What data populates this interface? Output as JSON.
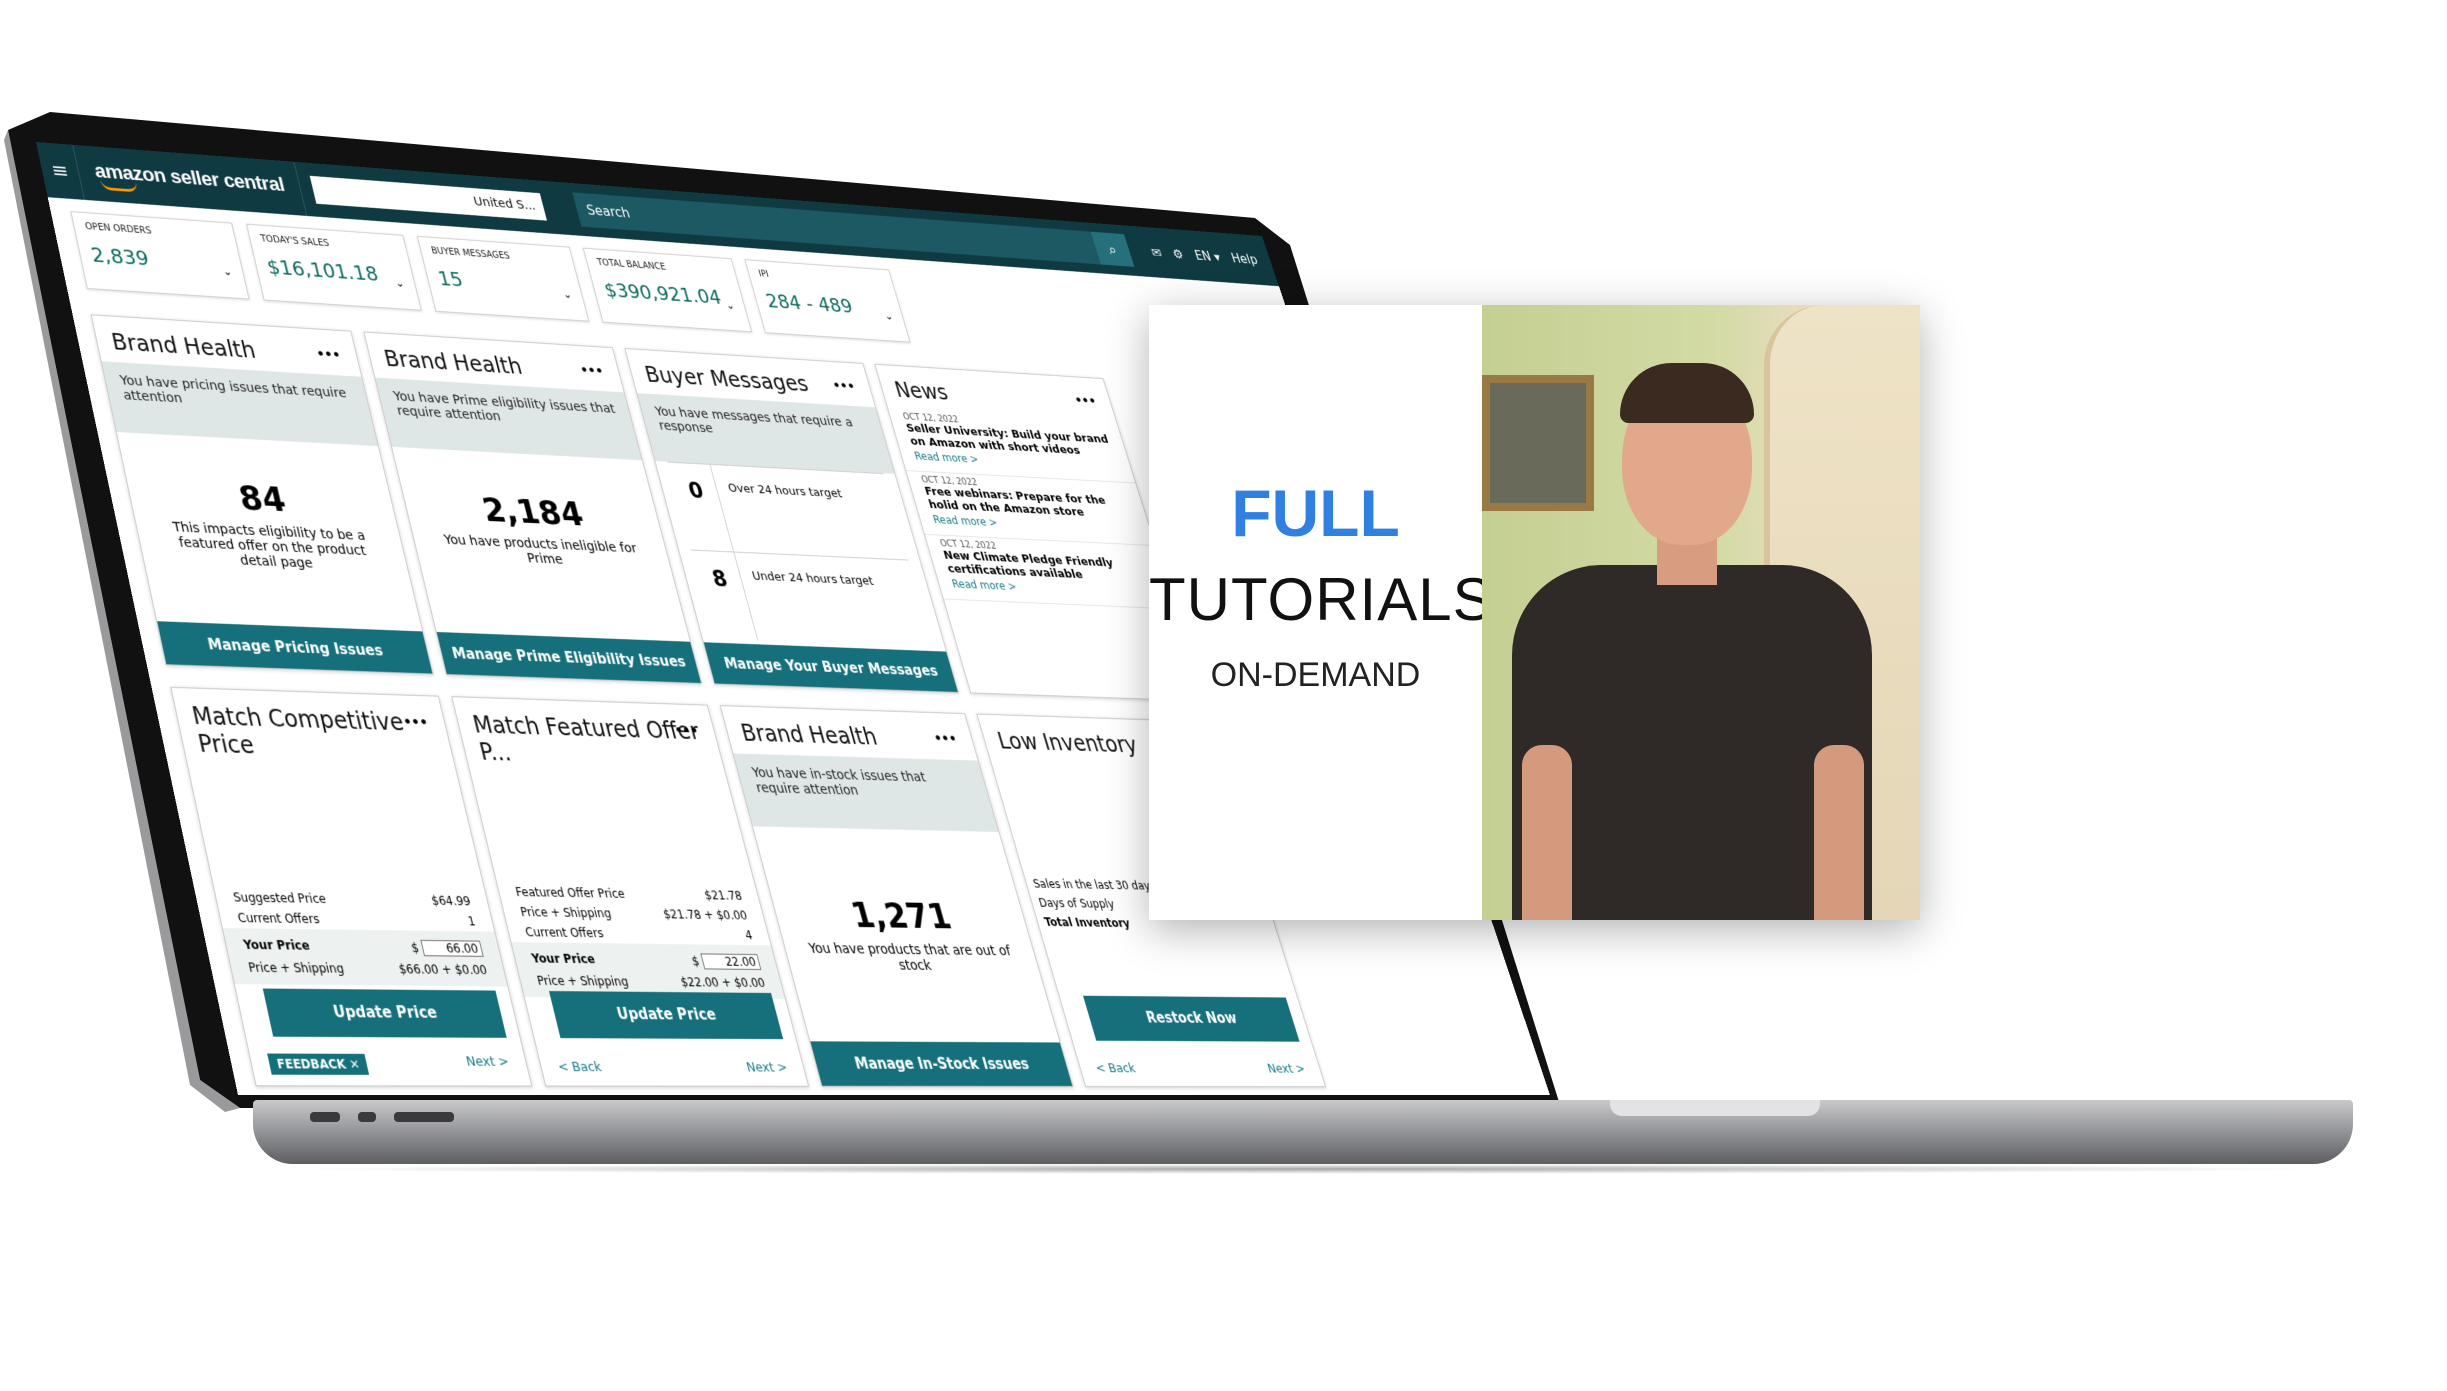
{
  "topbar": {
    "logo": "amazon seller central",
    "marketplace": "United S...",
    "search_placeholder": "Search",
    "language": "EN ▾",
    "help": "Help"
  },
  "stats": [
    {
      "label": "Open Orders",
      "value": "2,839"
    },
    {
      "label": "Today's Sales",
      "value": "$16,101.18"
    },
    {
      "label": "Buyer Messages",
      "value": "15"
    },
    {
      "label": "Total Balance",
      "value": "$390,921.04"
    },
    {
      "label": "IPI",
      "value": "284 - 489"
    }
  ],
  "cards": {
    "pricing": {
      "title": "Brand Health",
      "alert": "You have pricing issues that require attention",
      "count": "84",
      "desc": "This impacts eligibility to be a featured offer on the product detail page",
      "button": "Manage Pricing Issues"
    },
    "prime": {
      "title": "Brand Health",
      "alert": "You have Prime eligibility issues that require attention",
      "count": "2,184",
      "desc": "You have products ineligible for Prime",
      "button": "Manage Prime Eligibility Issues"
    },
    "messages": {
      "title": "Buyer Messages",
      "alert": "You have messages that require a response",
      "rows": [
        {
          "count": "0",
          "label": "Over 24 hours target"
        },
        {
          "count": "8",
          "label": "Under 24 hours target"
        }
      ],
      "button": "Manage Your Buyer Messages"
    },
    "news": {
      "title": "News",
      "items": [
        {
          "date": "OCT 12, 2022",
          "headline": "Seller University: Build your brand on Amazon with short videos",
          "link": "Read more >"
        },
        {
          "date": "OCT 12, 2022",
          "headline": "Free webinars: Prepare for the holid on the Amazon store",
          "link": "Read more >"
        },
        {
          "date": "OCT 12, 2022",
          "headline": "New Climate Pledge Friendly certifications available",
          "link": "Read more >"
        }
      ]
    },
    "competitive": {
      "title": "Match Competitive Price",
      "suggested_label": "Suggested Price",
      "suggested": "$64.99",
      "offers_label": "Current Offers",
      "offers": "1",
      "your_price_label": "Your Price",
      "currency": "$",
      "your_price": "66.00",
      "ps_label": "Price + Shipping",
      "ps": "$66.00 + $0.00",
      "button": "Update Price",
      "feedback": "FEEDBACK ✕",
      "next": "Next >"
    },
    "featured": {
      "title": "Match Featured Offer P...",
      "featured_label": "Featured Offer Price",
      "featured": "$21.78",
      "ps1_label": "Price + Shipping",
      "ps1": "$21.78 + $0.00",
      "offers_label": "Current Offers",
      "offers": "4",
      "your_price_label": "Your Price",
      "currency": "$",
      "your_price": "22.00",
      "ps_label": "Price + Shipping",
      "ps": "$22.00 + $0.00",
      "button": "Update Price",
      "back": "< Back",
      "next": "Next >"
    },
    "instock": {
      "title": "Brand Health",
      "alert": "You have in-stock issues that require attention",
      "count": "1,271",
      "desc": "You have products that are out of stock",
      "button": "Manage In-Stock Issues"
    },
    "inventory": {
      "title": "Low Inventory",
      "sales_label": "Sales in the last 30 days",
      "supply_label": "Days of Supply",
      "total_label": "Total Inventory",
      "button": "Restock Now",
      "back": "< Back",
      "next": "Next >"
    }
  },
  "promo": {
    "line1": "FULL",
    "line2": "TUTORIALS",
    "line3": "ON-DEMAND",
    "accent": "#2f80e0"
  },
  "colors": {
    "teal_bar": "#0f3a42",
    "button": "#16707c"
  }
}
